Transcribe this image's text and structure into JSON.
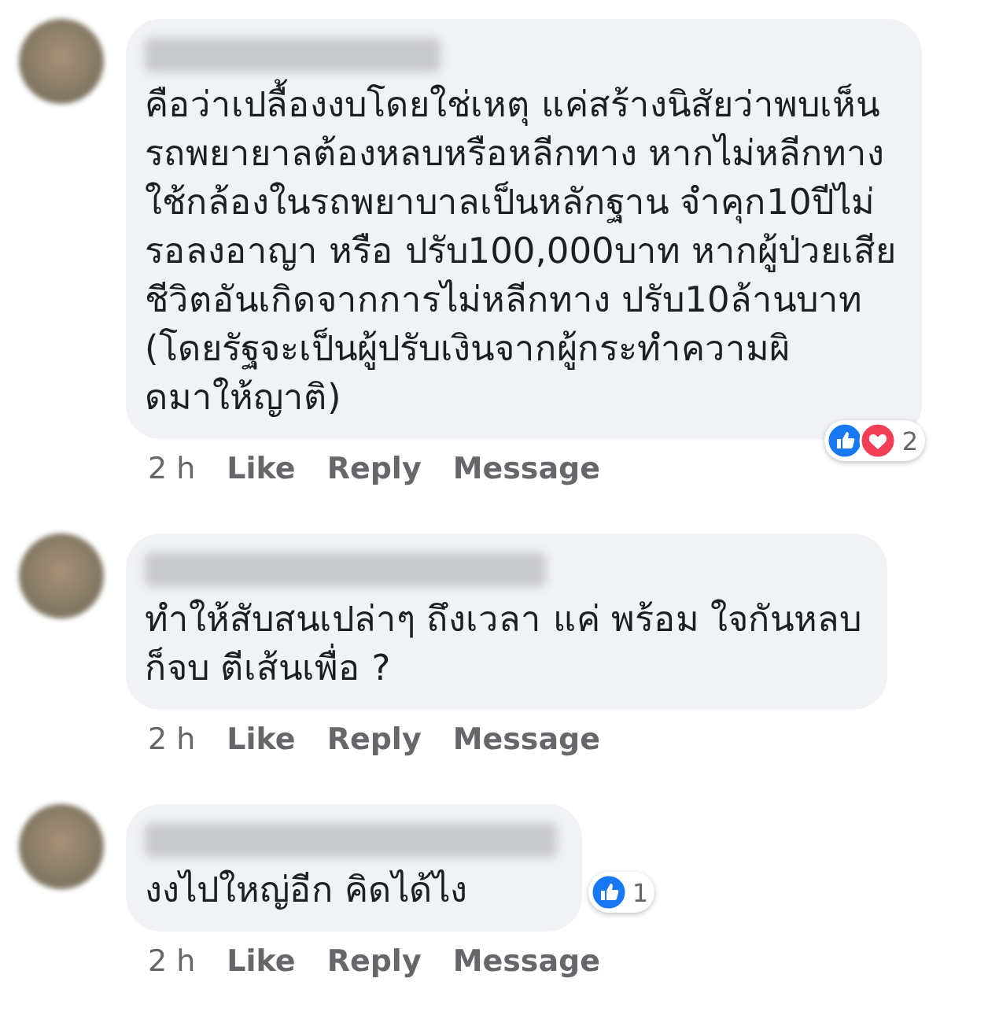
{
  "comments": [
    {
      "text": "คือว่าเปลื้องงบโดยใช่เหตุ แค่สร้างนิสัยว่าพบเห็น\nรถพยายาลต้องหลบหรือหลีกทาง หากไม่หลีกทาง\nใช้กล้องในรถพยาบาลเป็นหลักฐาน จำคุก10ปีไม่\nรอลงอาญา หรือ ปรับ100,000บาท หากผู้ป่วยเสีย\nชีวิตอันเกิดจากการไม่หลีกทาง ปรับ10ล้านบาท\n(โดยรัฐจะเป็นผู้ปรับเงินจากผู้กระทำความผิ\nดมาให้ญาติ)",
      "time": "2 h",
      "actions": [
        "Like",
        "Reply",
        "Message"
      ],
      "reactions": {
        "icons": [
          {
            "kind": "like"
          },
          {
            "kind": "love"
          }
        ],
        "count": "2"
      }
    },
    {
      "text": "ทำให้สับสนเปล่าๆ ถึงเวลา แค่ พร้อม ใจกันหลบ\nก็จบ ตีเส้นเพื่อ ?",
      "time": "2 h",
      "actions": [
        "Like",
        "Reply",
        "Message"
      ]
    },
    {
      "text": "งงไปใหญ่อีก คิดได้ไง",
      "time": "2 h",
      "actions": [
        "Like",
        "Reply",
        "Message"
      ],
      "reactions": {
        "icons": [
          {
            "kind": "like"
          }
        ],
        "count": "1"
      }
    }
  ]
}
